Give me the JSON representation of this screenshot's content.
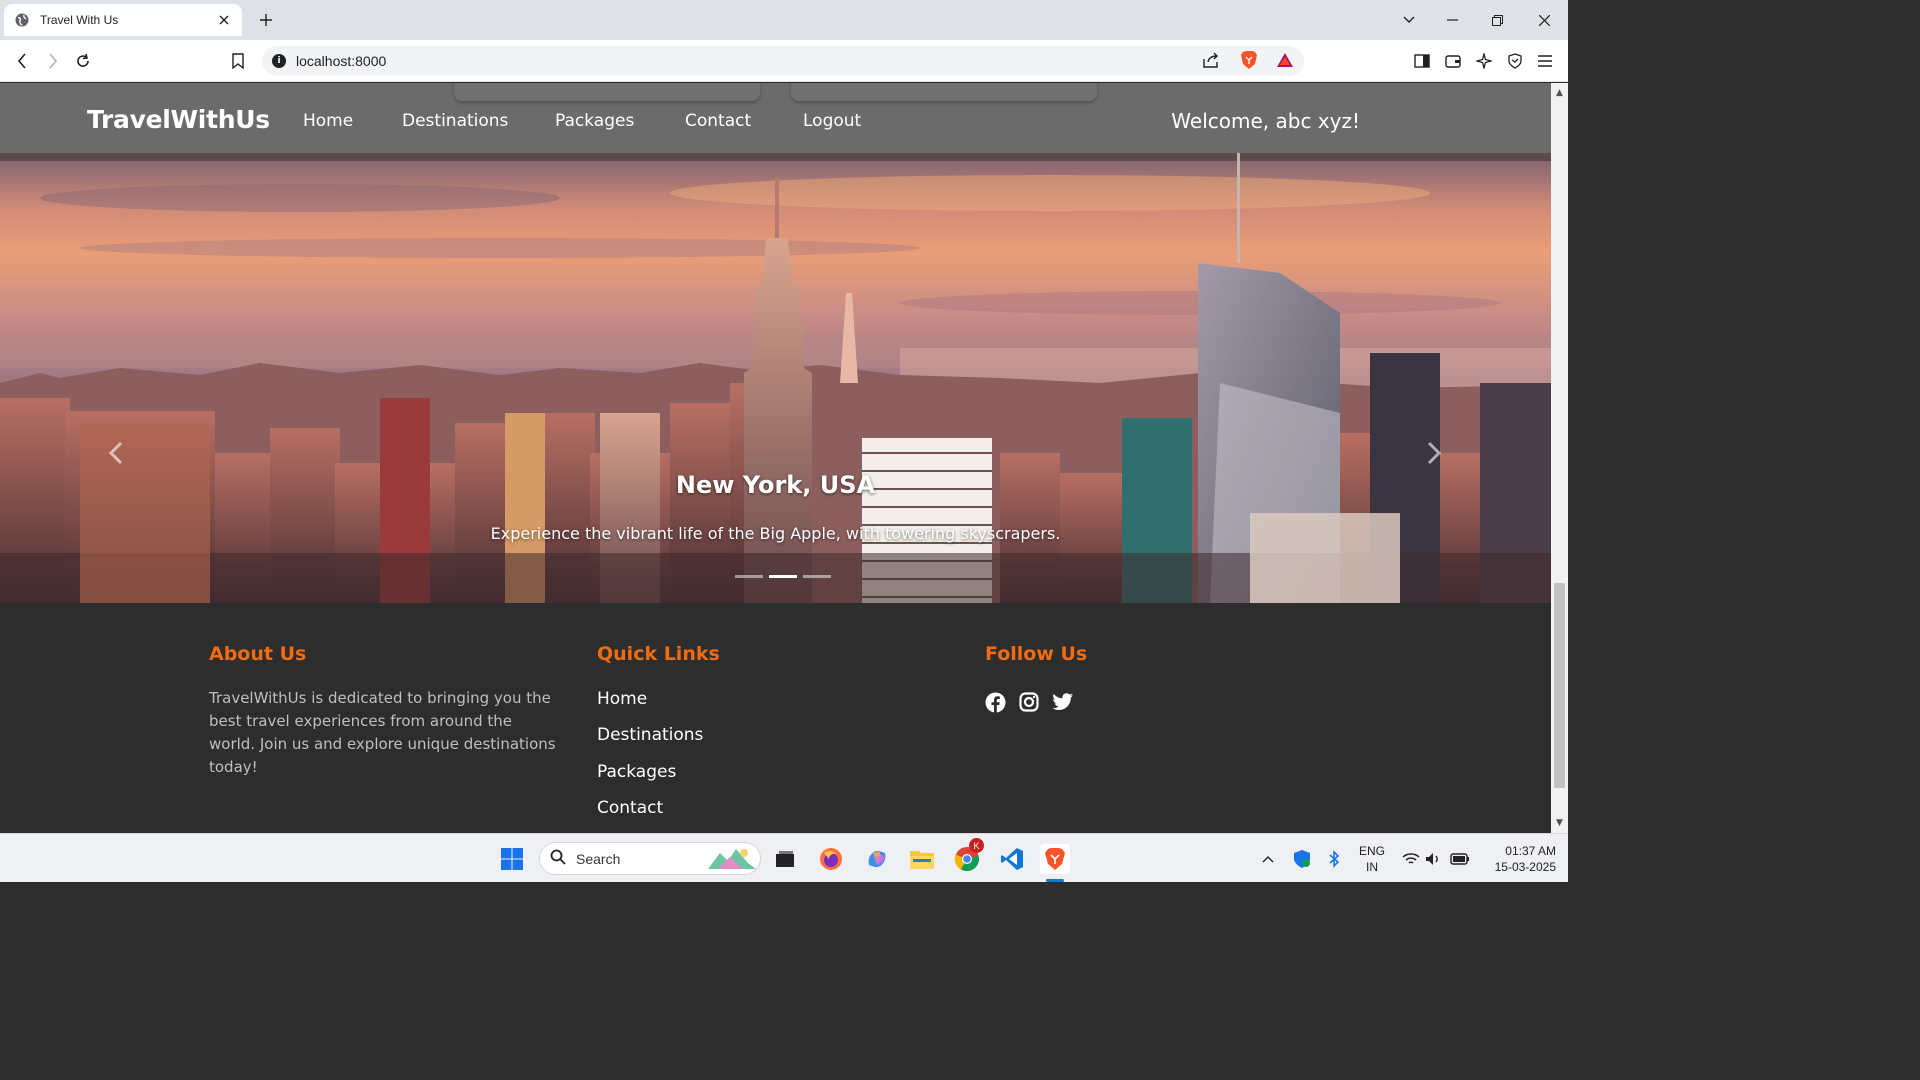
{
  "browser": {
    "tab_title": "Travel With Us",
    "url": "localhost:8000"
  },
  "navbar": {
    "brand": "TravelWithUs",
    "links": [
      "Home",
      "Destinations",
      "Packages",
      "Contact",
      "Logout"
    ],
    "welcome": "Welcome, abc xyz!"
  },
  "hero": {
    "title": "New York, USA",
    "subtitle": "Experience the vibrant life of the Big Apple, with towering skyscrapers.",
    "active_slide": 2,
    "slide_count": 3
  },
  "footer": {
    "about_heading": "About Us",
    "about_text": "TravelWithUs is dedicated to bringing you the best travel experiences from around the world. Join us and explore unique destinations today!",
    "quick_heading": "Quick Links",
    "quick_links": [
      "Home",
      "Destinations",
      "Packages",
      "Contact"
    ],
    "follow_heading": "Follow Us",
    "social_icons": [
      "facebook-icon",
      "instagram-icon",
      "twitter-icon"
    ],
    "accent_color": "#f26b0f"
  },
  "taskbar": {
    "search_label": "Search",
    "lang_line1": "ENG",
    "lang_line2": "IN",
    "time": "01:37 AM",
    "date": "15-03-2025",
    "chrome_badge": "K"
  }
}
